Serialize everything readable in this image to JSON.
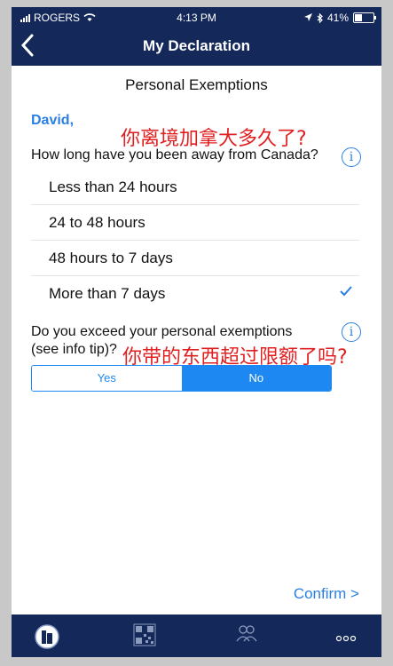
{
  "status_bar": {
    "carrier": "ROGERS",
    "time": "4:13 PM",
    "battery": "41%",
    "battery_level": 0.41
  },
  "nav": {
    "title": "My Declaration"
  },
  "section_title": "Personal Exemptions",
  "greeting": "David,",
  "annotation_1": "你离境加拿大多久了?",
  "question_1": "How long have you been away from Canada?",
  "options": [
    {
      "label": "Less than 24 hours",
      "selected": false
    },
    {
      "label": "24 to 48 hours",
      "selected": false
    },
    {
      "label": "48 hours to 7 days",
      "selected": false
    },
    {
      "label": "More than 7 days",
      "selected": true
    }
  ],
  "question_2_line1": "Do you exceed your personal exemptions",
  "question_2_line2": "(see info tip)?",
  "annotation_2": "你带的东西超过限额了吗?",
  "segmented": {
    "yes_label": "Yes",
    "no_label": "No",
    "selected": "No"
  },
  "confirm_label": "Confirm >",
  "tab_icons": [
    "building-icon",
    "qr-code-icon",
    "people-icon",
    "more-icon"
  ],
  "colors": {
    "nav_bg": "#14295a",
    "accent": "#2a7fe2",
    "annotation": "#e02020"
  }
}
